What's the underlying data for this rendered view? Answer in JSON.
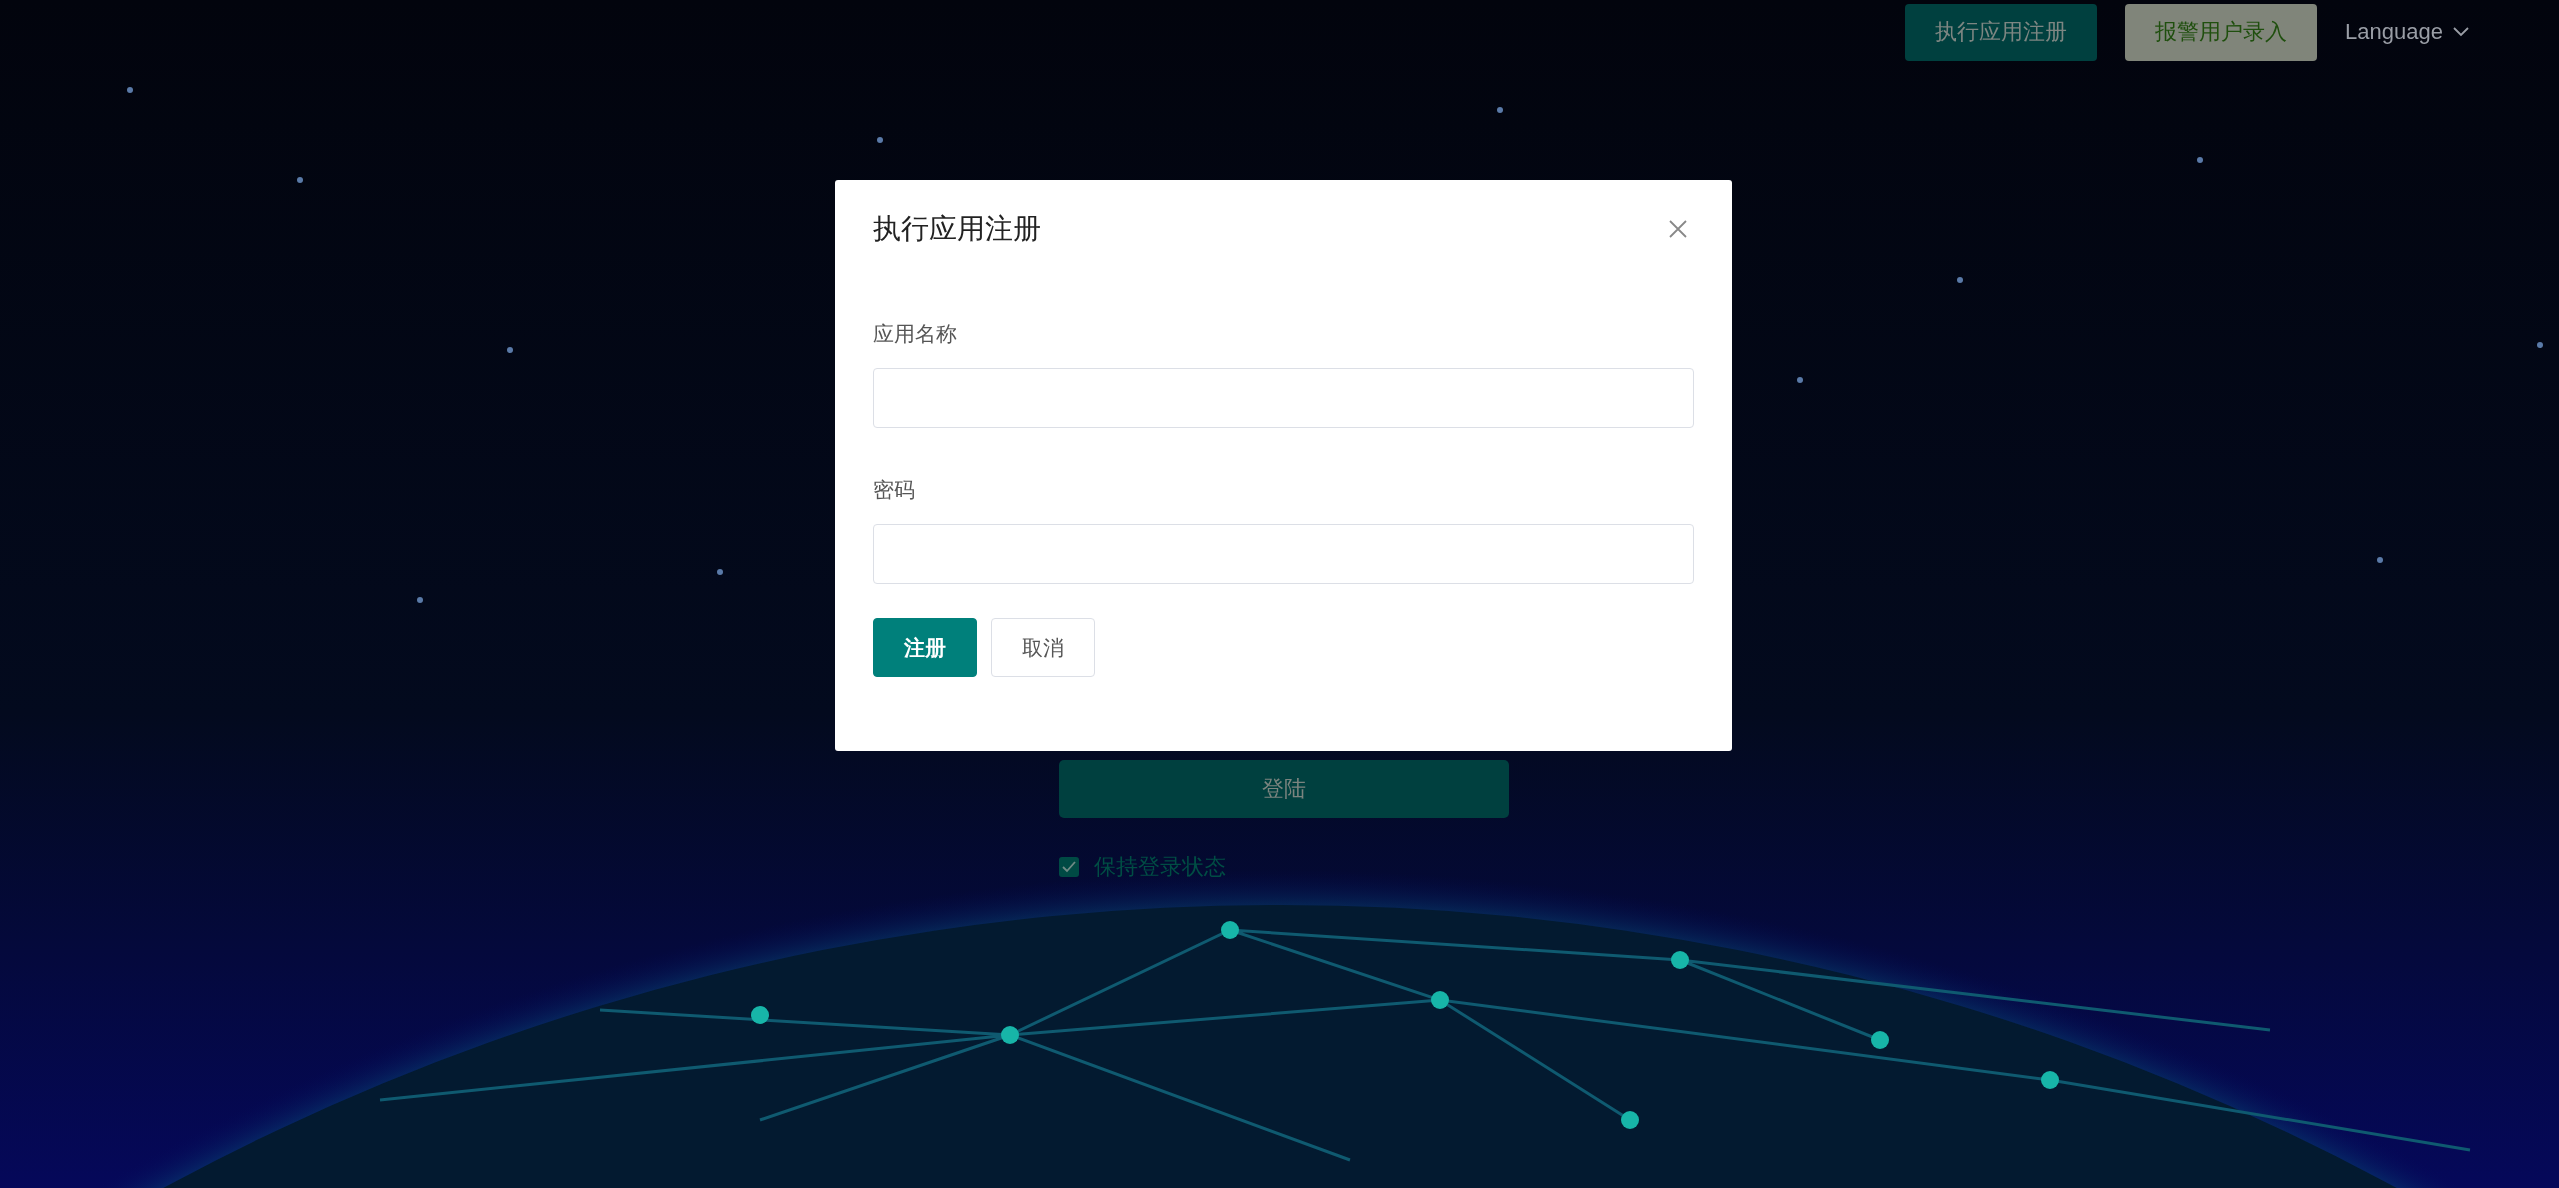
{
  "top_bar": {
    "buttons": [
      {
        "label": "执行应用注册",
        "kind": "primary"
      },
      {
        "label": "报警用户录入",
        "kind": "secondary"
      }
    ],
    "language": {
      "label": "Language"
    }
  },
  "login": {
    "button": "登陆",
    "remember": {
      "label": "保持登录状态",
      "checked": true
    }
  },
  "dialog": {
    "title": "执行应用注册",
    "fields": [
      {
        "label": "应用名称"
      },
      {
        "label": "密码"
      }
    ],
    "buttons": [
      {
        "label": "注册",
        "kind": "primary"
      },
      {
        "label": "取消",
        "kind": "default"
      }
    ]
  }
}
